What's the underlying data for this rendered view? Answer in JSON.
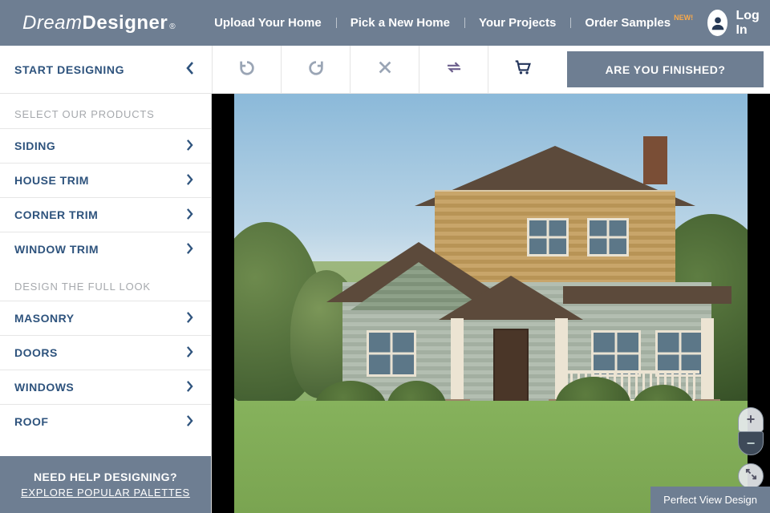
{
  "brand": {
    "part1": "Dream",
    "part2": "Designer",
    "reg": "®"
  },
  "nav": {
    "items": [
      {
        "label": "Upload Your Home"
      },
      {
        "label": "Pick a New Home"
      },
      {
        "label": "Your Projects"
      },
      {
        "label": "Order Samples"
      }
    ],
    "new_badge": "NEW!"
  },
  "login": {
    "label": "Log In"
  },
  "start": {
    "label": "START DESIGNING"
  },
  "toolbar": {
    "undo": "undo",
    "redo": "redo",
    "close": "close",
    "swap": "swap",
    "cart": "cart",
    "finish_label": "ARE YOU FINISHED?"
  },
  "sidebar": {
    "section1_title": "SELECT OUR PRODUCTS",
    "section1_items": [
      {
        "label": "SIDING"
      },
      {
        "label": "HOUSE TRIM"
      },
      {
        "label": "CORNER TRIM"
      },
      {
        "label": "WINDOW TRIM"
      }
    ],
    "section2_title": "DESIGN THE FULL LOOK",
    "section2_items": [
      {
        "label": "MASONRY"
      },
      {
        "label": "DOORS"
      },
      {
        "label": "WINDOWS"
      },
      {
        "label": "ROOF"
      }
    ]
  },
  "help": {
    "question": "NEED HELP DESIGNING?",
    "link": "EXPLORE POPULAR PALETTES"
  },
  "canvas": {
    "zoom_in": "+",
    "zoom_out": "−",
    "perfect_view": "Perfect View Design"
  },
  "colors": {
    "header_bg": "#6e7e92",
    "primary_text": "#2e537d",
    "badge": "#f9a94a"
  }
}
